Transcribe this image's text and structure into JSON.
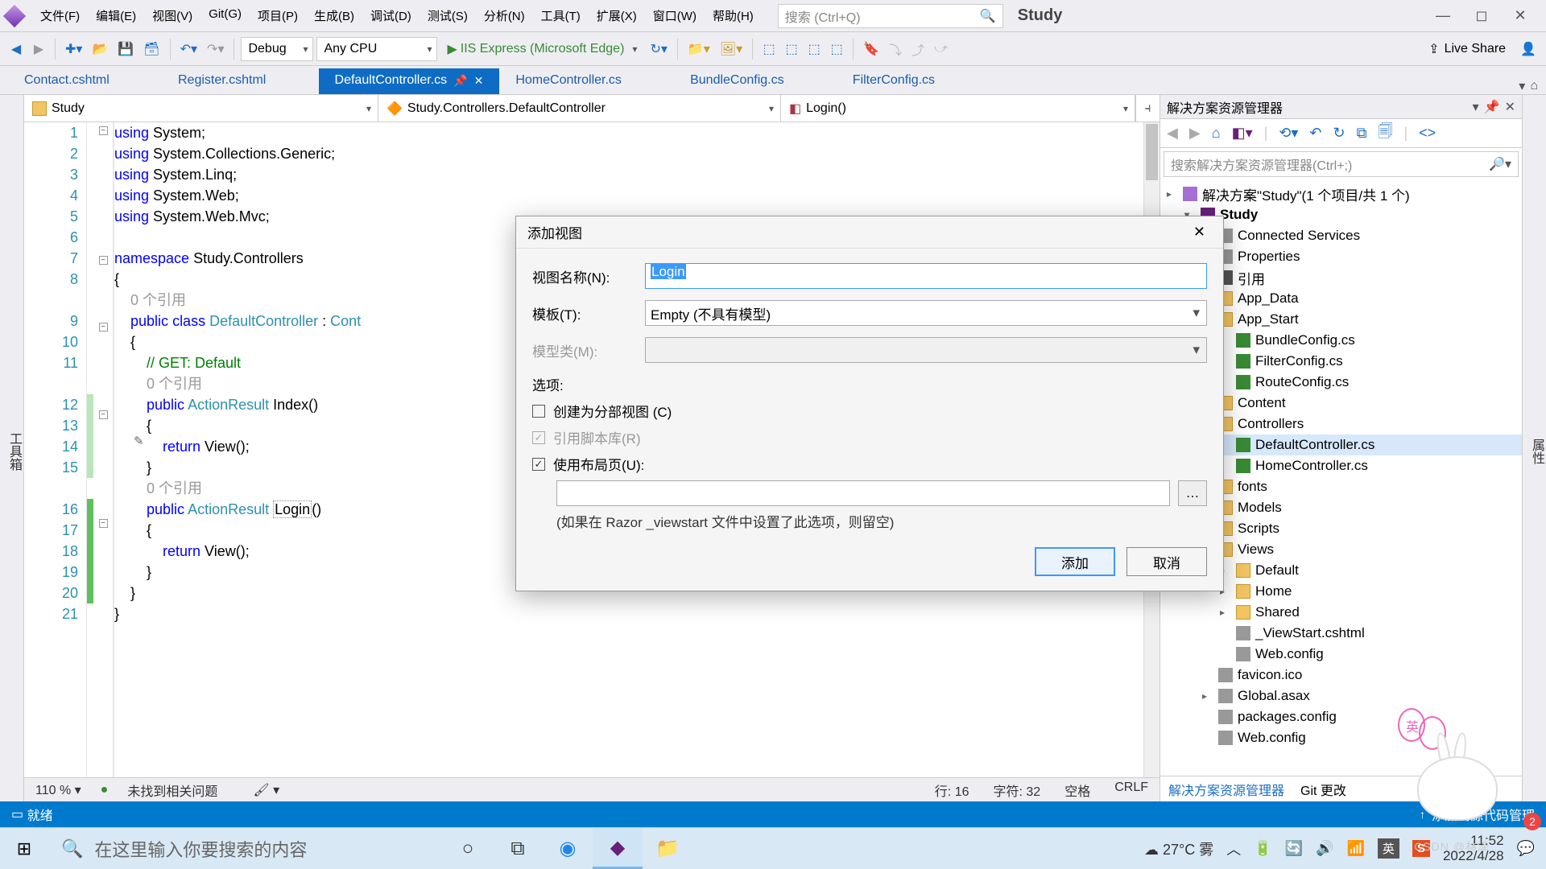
{
  "menu": [
    "文件(F)",
    "编辑(E)",
    "视图(V)",
    "Git(G)",
    "项目(P)",
    "生成(B)",
    "调试(D)",
    "测试(S)",
    "分析(N)",
    "工具(T)",
    "扩展(X)",
    "窗口(W)",
    "帮助(H)"
  ],
  "search_placeholder": "搜索 (Ctrl+Q)",
  "solution_name": "Study",
  "toolbar": {
    "config": "Debug",
    "platform": "Any CPU",
    "run": "IIS Express (Microsoft Edge)",
    "live_share": "Live Share"
  },
  "tabs": [
    "Contact.cshtml",
    "Register.cshtml",
    "DefaultController.cs",
    "HomeController.cs",
    "BundleConfig.cs",
    "FilterConfig.cs"
  ],
  "active_tab": 2,
  "nav": {
    "project": "Study",
    "class": "Study.Controllers.DefaultController",
    "member": "Login()"
  },
  "left_tool": "工具箱",
  "right_tool": "属性",
  "code": {
    "refs_text": "0 个引用",
    "lines_numbers": [
      1,
      2,
      3,
      4,
      5,
      6,
      7,
      8,
      "",
      9,
      10,
      11,
      "",
      12,
      13,
      14,
      15,
      "",
      16,
      17,
      18,
      19,
      20,
      21
    ]
  },
  "footer": {
    "zoom": "110 %",
    "issues": "未找到相关问题",
    "line": "行: 16",
    "col": "字符: 32",
    "ws": "空格",
    "eol": "CRLF"
  },
  "dialog": {
    "title": "添加视图",
    "label_name": "视图名称(N):",
    "value_name": "Login",
    "label_tpl": "模板(T):",
    "value_tpl": "Empty (不具有模型)",
    "label_model": "模型类(M):",
    "label_options": "选项:",
    "opt_partial": "创建为分部视图 (C)",
    "opt_scripts": "引用脚本库(R)",
    "opt_layout": "使用布局页(U):",
    "note": "(如果在 Razor _viewstart 文件中设置了此选项，则留空)",
    "btn_ok": "添加",
    "btn_cancel": "取消"
  },
  "sx": {
    "title": "解决方案资源管理器",
    "search": "搜索解决方案资源管理器(Ctrl+;)",
    "solution": "解决方案\"Study\"(1 个项目/共 1 个)",
    "project": "Study",
    "nodes_top": [
      "Connected Services",
      "Properties",
      "引用",
      "App_Data",
      "App_Start"
    ],
    "appstart": [
      "BundleConfig.cs",
      "FilterConfig.cs",
      "RouteConfig.cs"
    ],
    "nodes_mid": [
      "Content",
      "Controllers"
    ],
    "controllers": [
      "DefaultController.cs",
      "HomeController.cs"
    ],
    "nodes_after": [
      "fonts",
      "Models",
      "Scripts",
      "Views"
    ],
    "views": [
      "Default",
      "Home",
      "Shared",
      "_ViewStart.cshtml",
      "Web.config"
    ],
    "nodes_tail": [
      "favicon.ico",
      "Global.asax",
      "packages.config",
      "Web.config"
    ],
    "footer_left": "解决方案资源管理器",
    "footer_right": "Git 更改"
  },
  "vs_status": {
    "left": "就绪",
    "right": "添加到源代码管理",
    "up": "↑"
  },
  "win": {
    "search": "在这里输入你要搜索的内容",
    "weather": "27°C  雾",
    "ime": "英",
    "time": "11:52",
    "date": "2022/4/28"
  },
  "mascot_txt": "英",
  "watermark": "CSDN @林泽"
}
